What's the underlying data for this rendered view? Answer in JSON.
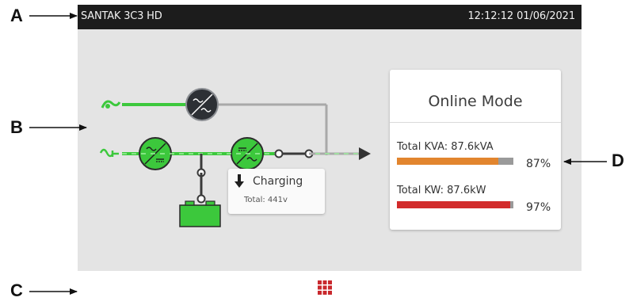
{
  "callouts": [
    "A",
    "B",
    "C",
    "D"
  ],
  "header": {
    "title": "SANTAK 3C3 HD",
    "datetime": "12:12:12 01/06/2021"
  },
  "colors": {
    "active_line": "#3cc83c",
    "inactive_line": "#a9a9a9",
    "kva_bar": "#e2852e",
    "kw_bar": "#d22b2b",
    "menu_icon": "#c9282d",
    "topbar": "#1c1c1c"
  },
  "flow_icons": [
    "bypass-source-icon",
    "mains-source-icon",
    "static-switch-icon",
    "rectifier-icon",
    "inverter-icon",
    "battery-icon",
    "output-arrow-icon"
  ],
  "battery": {
    "status": "Charging",
    "total": "Total:  441v"
  },
  "status": {
    "mode": "Online Mode",
    "kva_label": "Total KVA: 87.6kVA",
    "kva_percent": "87%",
    "kva_value": 87,
    "kw_label": "Total KW: 87.6kW",
    "kw_percent": "97%",
    "kw_value": 97
  },
  "bottombar": {
    "menu_icon": "grid-menu-icon"
  }
}
